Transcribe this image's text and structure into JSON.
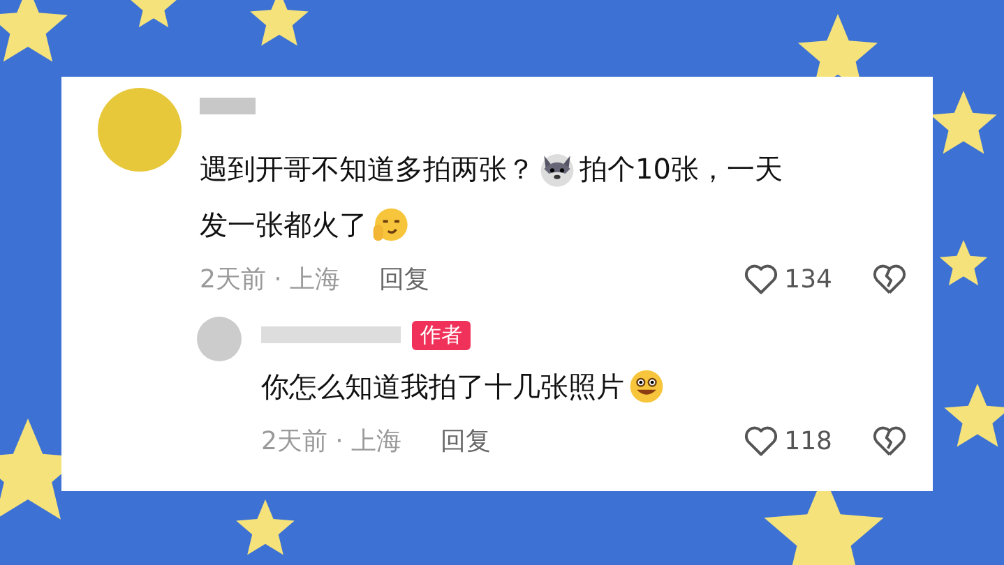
{
  "comments": [
    {
      "lines": [
        [
          {
            "kind": "text",
            "text": "遇到开哥不知道多拍两张？"
          },
          {
            "kind": "wolf_emoji"
          },
          {
            "kind": "text",
            "text": "拍个10张，一天"
          }
        ],
        [
          {
            "kind": "text",
            "text": "发一张都火了"
          },
          {
            "kind": "face_emoji"
          }
        ]
      ],
      "time": "2天前 · 上海",
      "reply": "回复",
      "likes": "134",
      "replies": [
        {
          "lines": [
            [
              {
                "kind": "text",
                "text": "你怎么知道我拍了十几张照片"
              },
              {
                "kind": "grin_emoji"
              }
            ]
          ],
          "time": "2天前 · 上海",
          "reply": "回复",
          "likes": "118",
          "badge": "作者"
        }
      ]
    }
  ]
}
